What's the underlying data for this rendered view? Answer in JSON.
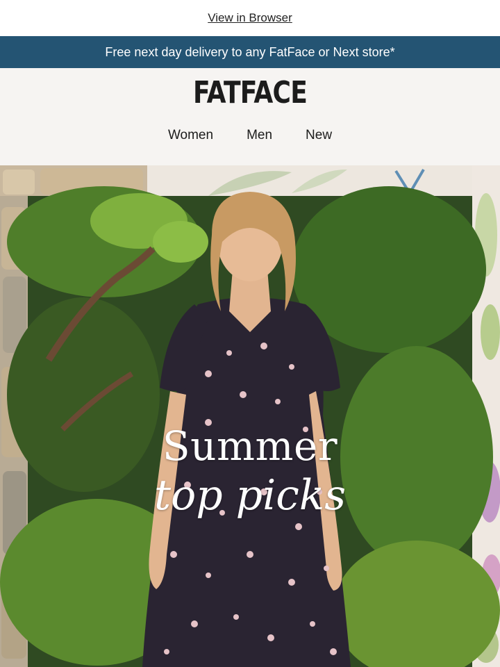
{
  "top_link": "View in Browser",
  "banner": {
    "text": "Free next day delivery to any FatFace or Next store*",
    "color": "#245473"
  },
  "header": {
    "logo": "FATFACE",
    "nav": [
      "Women",
      "Men",
      "New"
    ]
  },
  "hero": {
    "line1": "Summer",
    "line2": "top picks"
  }
}
